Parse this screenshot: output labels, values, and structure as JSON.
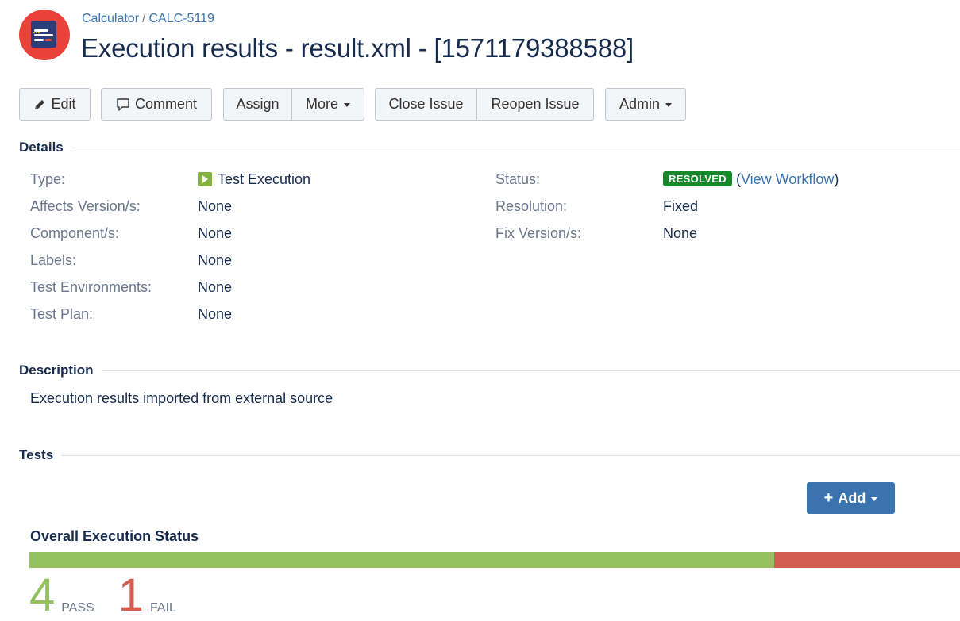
{
  "header": {
    "breadcrumb_project": "Calculator",
    "breadcrumb_sep": "/",
    "breadcrumb_issue": "CALC-5119",
    "summary": "Execution results - result.xml - [1571179388588]"
  },
  "toolbar": {
    "edit": "Edit",
    "comment": "Comment",
    "assign": "Assign",
    "more": "More",
    "close_issue": "Close Issue",
    "reopen_issue": "Reopen Issue",
    "admin": "Admin"
  },
  "details": {
    "heading": "Details",
    "left": [
      {
        "label": "Type:",
        "value": "Test Execution"
      },
      {
        "label": "Affects Version/s:",
        "value": "None"
      },
      {
        "label": "Component/s:",
        "value": "None"
      },
      {
        "label": "Labels:",
        "value": "None"
      },
      {
        "label": "Test Environments:",
        "value": "None"
      },
      {
        "label": "Test Plan:",
        "value": "None"
      }
    ],
    "right": [
      {
        "label": "Status:",
        "value": "RESOLVED",
        "link_open": "(",
        "link": "View Workflow",
        "link_close": ")"
      },
      {
        "label": "Resolution:",
        "value": "Fixed"
      },
      {
        "label": "Fix Version/s:",
        "value": "None"
      }
    ]
  },
  "description": {
    "heading": "Description",
    "text": "Execution results imported from external source"
  },
  "tests": {
    "heading": "Tests",
    "add_label": "Add",
    "overall_title": "Overall Execution Status",
    "progress": [
      {
        "status": "PASS",
        "count": "4",
        "fraction": 0.8,
        "color": "#95c160"
      },
      {
        "status": "FAIL",
        "count": "1",
        "fraction": 0.2,
        "color": "#d45d52"
      }
    ]
  },
  "colors": {
    "link": "#3b73af",
    "resolved_lozenge": "#14892c",
    "add_button": "#3b73af"
  }
}
